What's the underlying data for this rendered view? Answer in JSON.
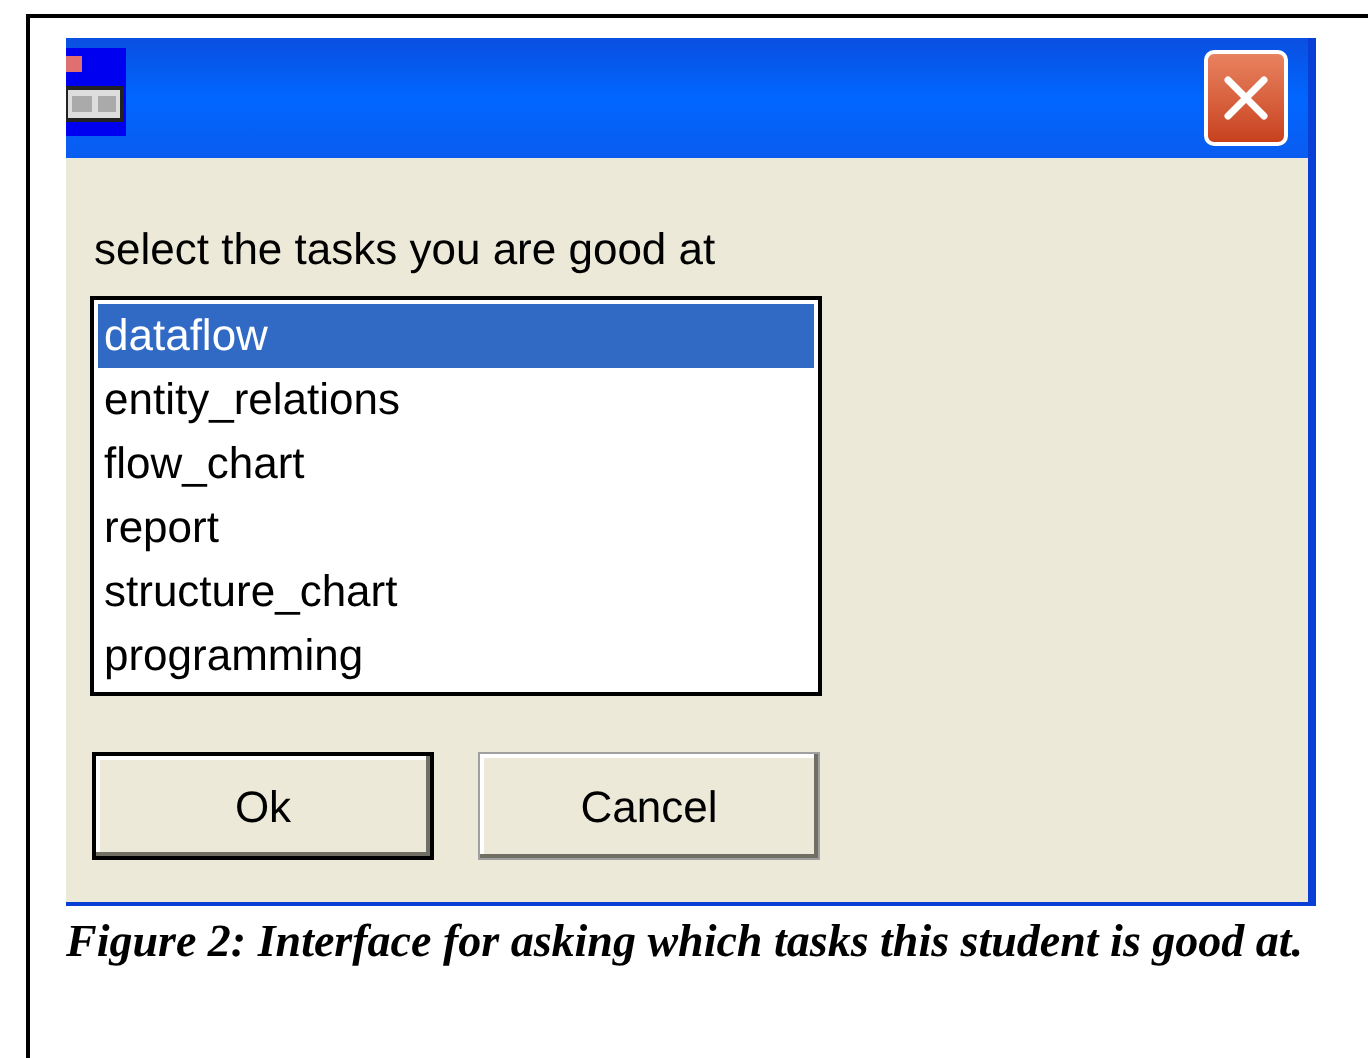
{
  "dialog": {
    "prompt": "select the tasks you are good at",
    "tasks": [
      {
        "label": "dataflow",
        "selected": true
      },
      {
        "label": "entity_relations",
        "selected": false
      },
      {
        "label": "flow_chart",
        "selected": false
      },
      {
        "label": "report",
        "selected": false
      },
      {
        "label": "structure_chart",
        "selected": false
      },
      {
        "label": "programming",
        "selected": false
      }
    ],
    "buttons": [
      {
        "label": "Ok",
        "default": true
      },
      {
        "label": "Cancel",
        "default": false
      }
    ]
  },
  "caption": "Figure 2: Interface for asking which tasks this student is good at."
}
